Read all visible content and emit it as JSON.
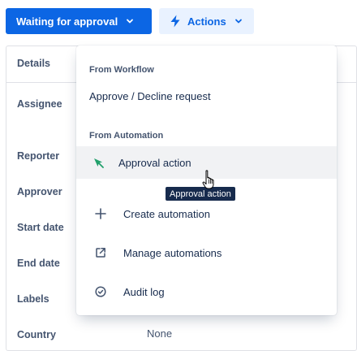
{
  "toolbar": {
    "status_label": "Waiting for approval",
    "actions_label": "Actions"
  },
  "details": {
    "header": "Details",
    "fields": [
      {
        "label": "Assignee",
        "value": ""
      },
      {
        "label": "Reporter",
        "value": ""
      },
      {
        "label": "Approver",
        "value": ""
      },
      {
        "label": "Start date",
        "value": ""
      },
      {
        "label": "End date",
        "value": ""
      },
      {
        "label": "Labels",
        "value": ""
      },
      {
        "label": "Country",
        "value": "None"
      }
    ]
  },
  "menu": {
    "workflow_heading": "From Workflow",
    "workflow_item": "Approve / Decline request",
    "automation_heading": "From Automation",
    "items": [
      {
        "label": "Approval action",
        "icon": "approval-action-icon"
      },
      {
        "label": "Create automation",
        "icon": "plus-icon"
      },
      {
        "label": "Manage automations",
        "icon": "external-link-icon"
      },
      {
        "label": "Audit log",
        "icon": "check-circle-icon"
      }
    ]
  },
  "tooltip": "Approval action",
  "colors": {
    "primary": "#0c66e4",
    "primary_subtle": "#e9f2ff",
    "approval_icon": "#22a06b",
    "text": "#172b4d",
    "subtle_text": "#44546f"
  }
}
